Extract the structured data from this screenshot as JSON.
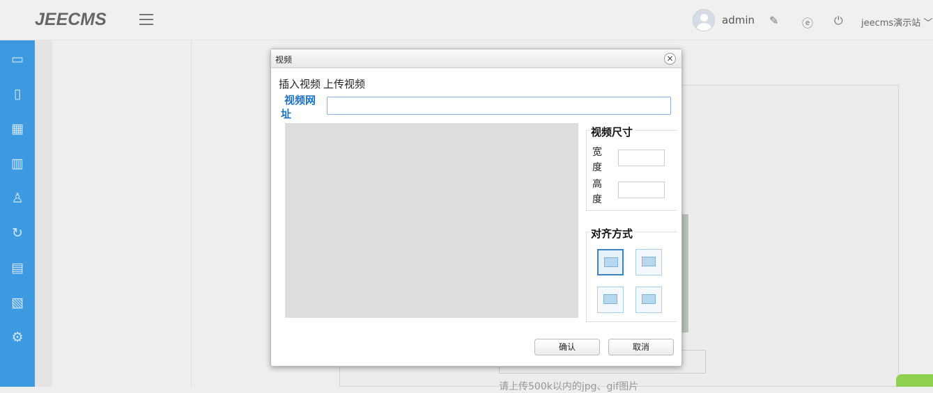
{
  "header": {
    "logo": "JEECMS",
    "username": "admin",
    "site": "jeecms演示站 ﹀"
  },
  "background": {
    "upload_hint": "请上传500k以内的jpg、gif图片"
  },
  "dialog": {
    "title": "视频",
    "close": "×",
    "tabs": [
      "插入视频",
      "上传视频"
    ],
    "url_label": "视频网址",
    "url_value": "",
    "size_legend": "视频尺寸",
    "width_label": "宽度",
    "height_label": "高度",
    "width_value": "",
    "height_value": "",
    "align_legend": "对齐方式",
    "align_options": [
      "none",
      "left",
      "right",
      "center"
    ],
    "selected_align": "none",
    "confirm": "确认",
    "cancel": "取消"
  }
}
